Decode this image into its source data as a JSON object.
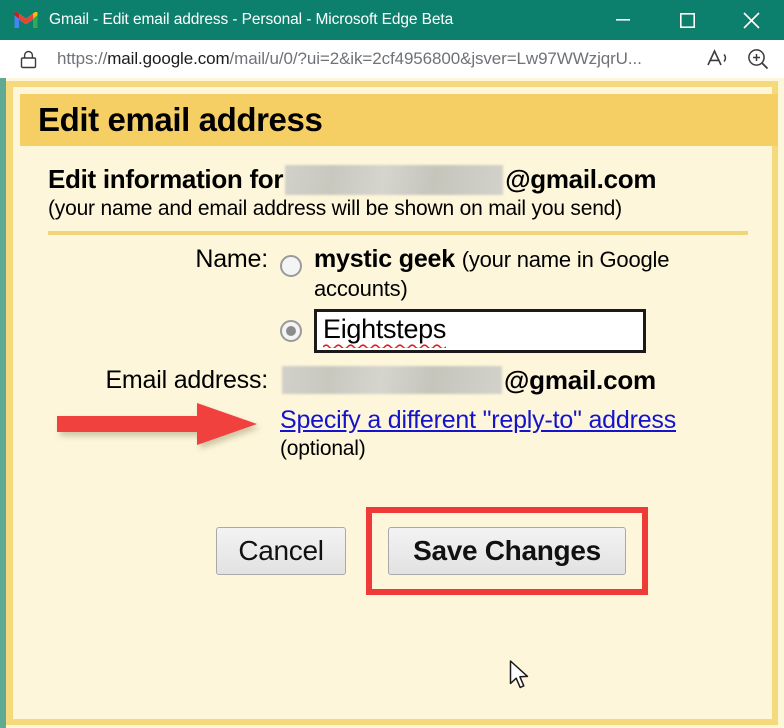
{
  "window": {
    "title": "Gmail - Edit email address - Personal - Microsoft Edge Beta",
    "logo_icon": "gmail-m-icon",
    "controls": {
      "minimize": "minimize-icon",
      "maximize": "maximize-icon",
      "close": "close-icon"
    },
    "titlebar_color": "#0c7f6d"
  },
  "address_bar": {
    "lock_icon": "lock-icon",
    "url_scheme": "https://",
    "url_host": "mail.google.com",
    "url_path": "/mail/u/0/?ui=2&ik=2cf4956800&jsver=Lw97WWzjqrU...",
    "read_aloud_icon": "read-aloud-icon",
    "zoom_icon": "zoom-magnifier-icon"
  },
  "dialog": {
    "header_title": "Edit email address",
    "header_color": "#f5cf64",
    "background_color": "#fdf6da",
    "info_prefix": "Edit information for",
    "info_redacted": "",
    "info_domain": "@gmail.com",
    "info_subtitle": "(your name and email address will be shown on mail you send)"
  },
  "form": {
    "name_label": "Name:",
    "option_account": {
      "selected": false,
      "value": "mystic geek",
      "hint": "(your name in Google accounts)"
    },
    "option_custom": {
      "selected": true,
      "value": "Eightsteps",
      "spellcheck_underline": true
    },
    "email_label": "Email address:",
    "email_redacted": "",
    "email_domain": "@gmail.com",
    "replyto_link": "Specify a different \"reply-to\" address",
    "replyto_optional": "(optional)"
  },
  "buttons": {
    "cancel_label": "Cancel",
    "save_label": "Save Changes",
    "highlight_color": "#ef3b38"
  },
  "annotations": {
    "arrow_icon": "red-right-arrow-icon",
    "arrow_color": "#f0413f",
    "cursor_icon": "mouse-pointer-icon",
    "save_highlight_icon": "red-rectangle-highlight"
  }
}
